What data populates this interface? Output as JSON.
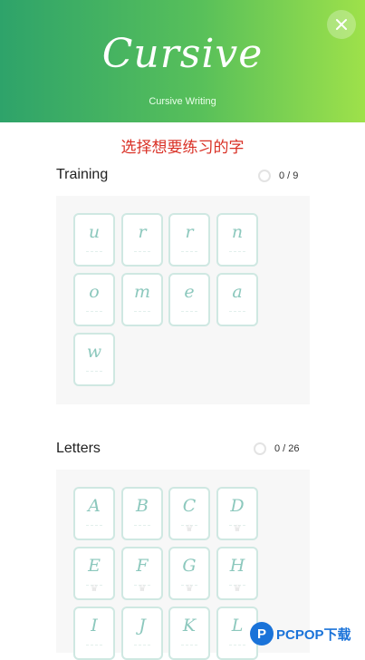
{
  "header": {
    "logo_text": "Cursive",
    "subtitle": "Cursive Writing"
  },
  "instruction": "选择想要练习的字",
  "training": {
    "title": "Training",
    "progress": "0 / 9",
    "cards": [
      "u",
      "r",
      "r",
      "n",
      "o",
      "m",
      "e",
      "a",
      "w"
    ]
  },
  "letters": {
    "title": "Letters",
    "progress": "0 / 26",
    "cards": [
      "A",
      "B",
      "C",
      "D",
      "E",
      "F",
      "G",
      "H",
      "I",
      "J",
      "K",
      "L"
    ]
  },
  "watermark": {
    "logo_letter": "P",
    "text": "PCPOP下载"
  },
  "colors": {
    "header_start": "#2ea36a",
    "header_end": "#9ee14a",
    "instruction": "#d93025",
    "card_border": "#cfe8e2",
    "glyph": "#8cc8bd"
  },
  "icons": {
    "close": "close-icon",
    "card_lock": "crown-icon",
    "progress": "progress-ring-icon"
  }
}
